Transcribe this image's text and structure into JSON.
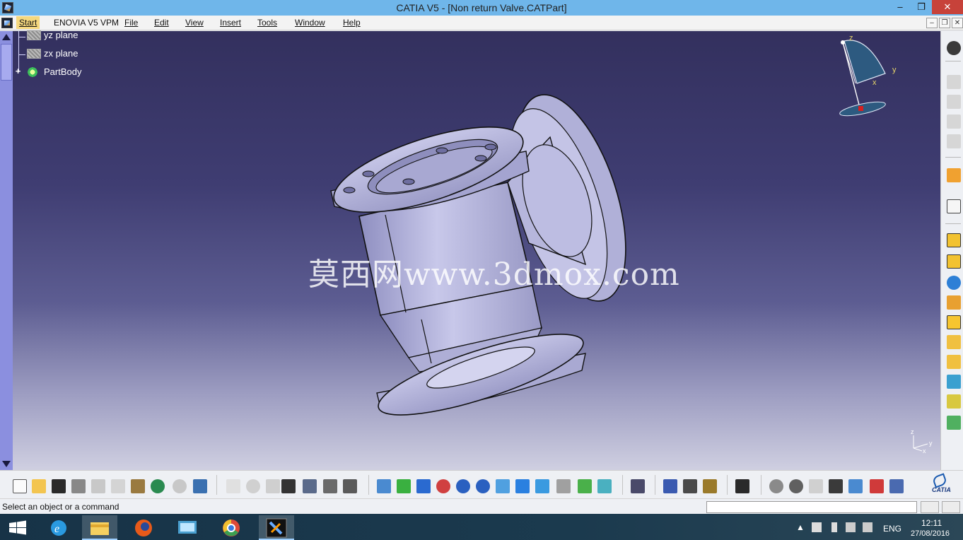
{
  "window": {
    "title": "CATIA V5 - [Non return Valve.CATPart]",
    "minimize": "–",
    "maximize": "❐",
    "close": "✕"
  },
  "menubar": {
    "items": [
      "Start",
      "ENOVIA V5 VPM",
      "File",
      "Edit",
      "View",
      "Insert",
      "Tools",
      "Window",
      "Help"
    ],
    "mdi_minimize": "–",
    "mdi_restore": "❐",
    "mdi_close": "✕"
  },
  "tree": {
    "items": [
      {
        "label": "yz plane",
        "icon": "plane-icon"
      },
      {
        "label": "zx plane",
        "icon": "plane-icon"
      },
      {
        "label": "PartBody",
        "icon": "part-body-icon"
      }
    ],
    "expand_symbol": "+"
  },
  "compass": {
    "x": "x",
    "y": "y",
    "z": "z"
  },
  "axis_gizmo": {
    "x": "x",
    "y": "y",
    "z": "z"
  },
  "watermark": "莫西网www.3dmox.com",
  "status": {
    "message": "Select an object or a command"
  },
  "taskbar": {
    "language": "ENG",
    "time": "12:11",
    "date": "27/08/2016"
  },
  "brand": "CATIA",
  "colors": {
    "titlebar": "#6fb6ea",
    "viewport_top": "#33305e",
    "viewport_bottom": "#cfcfe1",
    "part_fill": "#b9b9dc",
    "close_button": "#c7423a"
  }
}
